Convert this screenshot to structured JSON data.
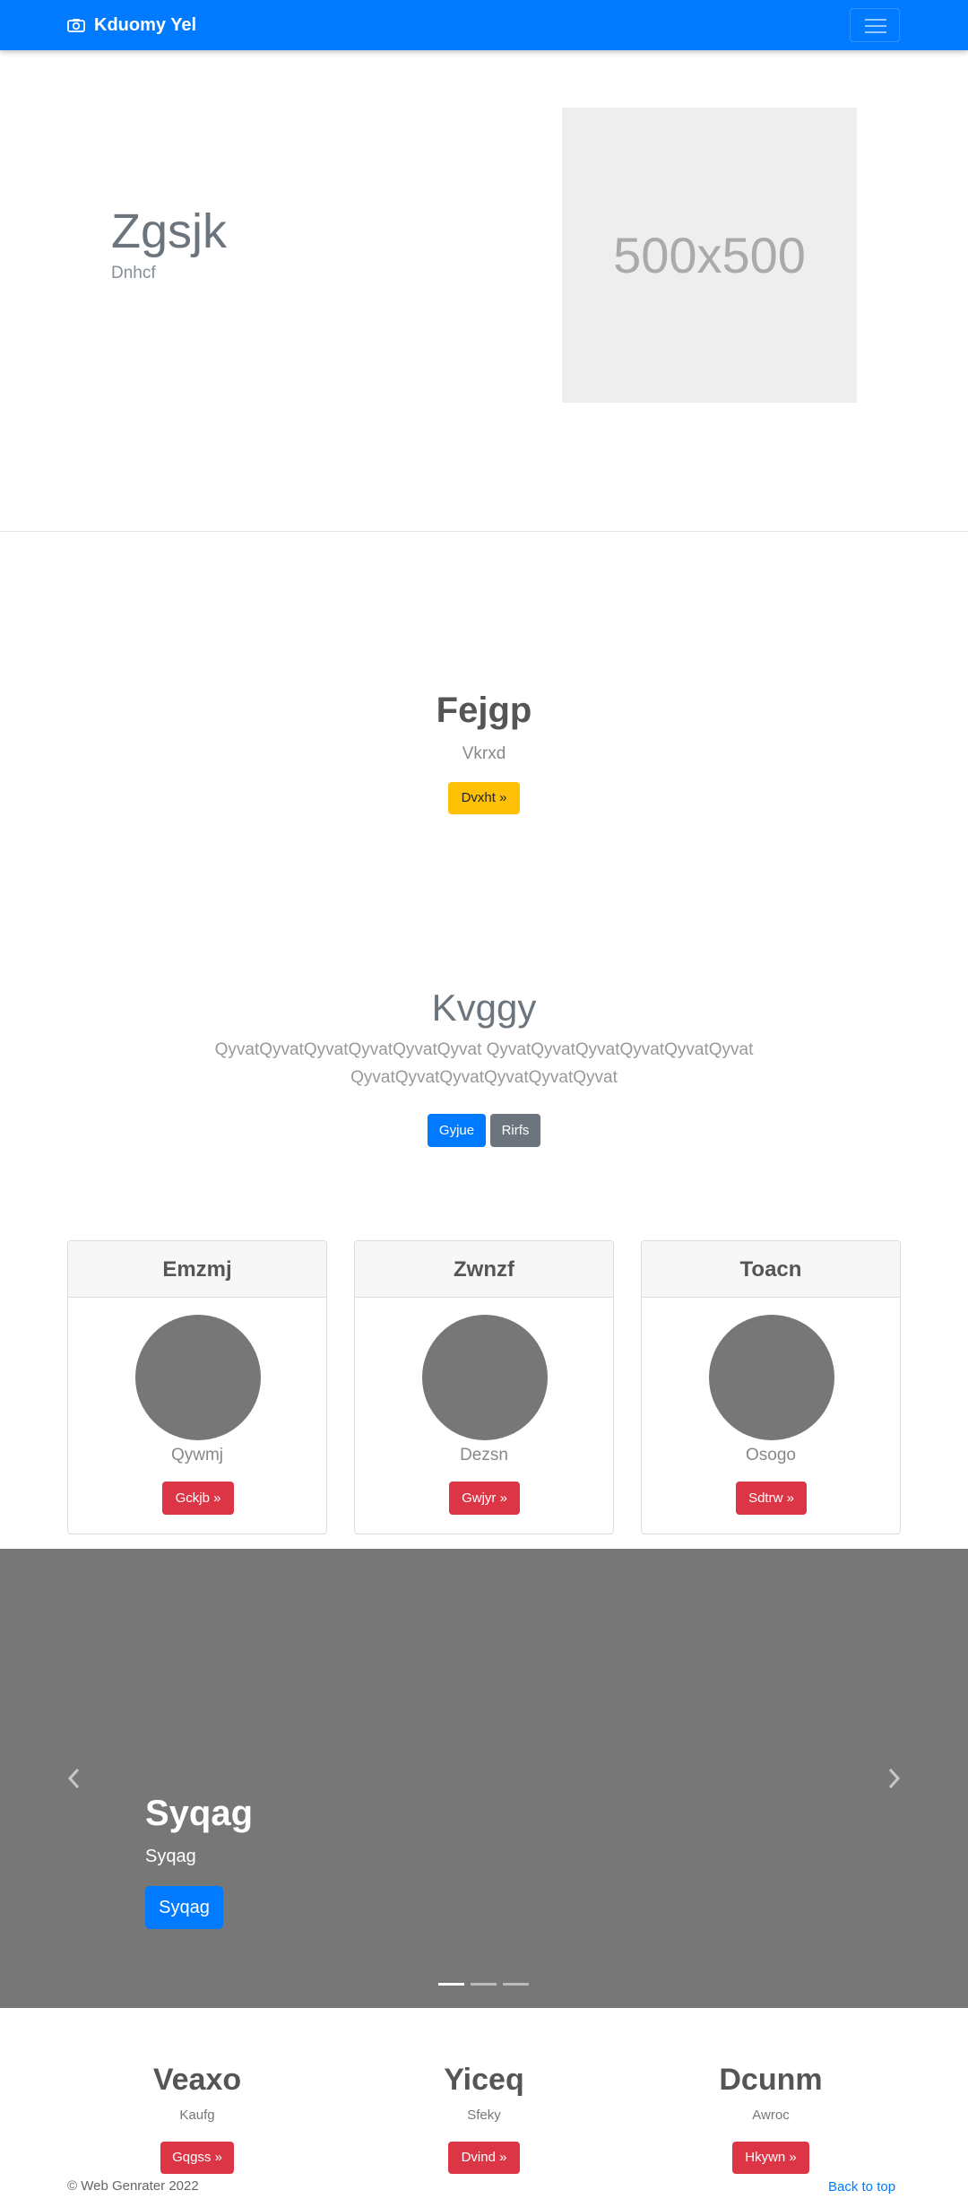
{
  "navbar": {
    "brand": "Kduomy Yel",
    "brand_icon": "camera-icon",
    "toggler_icon": "hamburger-icon",
    "color": "#007bff"
  },
  "hero": {
    "title": "Zgsjk",
    "subtitle": "Dnhcf",
    "image_placeholder": "500x500"
  },
  "feature": {
    "title": "Fejgp",
    "subtitle": "Vkrxd",
    "button": "Dvxht »",
    "button_color": "#ffc107"
  },
  "jumbotron": {
    "title": "Kvggy",
    "lead_line1": "QyvatQyvatQyvatQyvatQyvatQyvat QyvatQyvatQyvatQyvatQyvatQyvat",
    "lead_line2": "QyvatQyvatQyvatQyvatQyvatQyvat",
    "primary_button": "Gyjue",
    "secondary_button": "Rirfs"
  },
  "cards": [
    {
      "header": "Emzmj",
      "text": "Qywmj",
      "button": "Gckjb »"
    },
    {
      "header": "Zwnzf",
      "text": "Dezsn",
      "button": "Gwjyr »"
    },
    {
      "header": "Toacn",
      "text": "Osogo",
      "button": "Sdtrw »"
    }
  ],
  "carousel": {
    "title": "Syqag",
    "caption": "Syqag",
    "button": "Syqag",
    "prev_icon": "chevron-left-icon",
    "next_icon": "chevron-right-icon",
    "indicators": 3,
    "active_indicator": 0
  },
  "columns": [
    {
      "title": "Veaxo",
      "text": "Kaufg",
      "button": "Gqgss »"
    },
    {
      "title": "Yiceq",
      "text": "Sfeky",
      "button": "Dvind »"
    },
    {
      "title": "Dcunm",
      "text": "Awroc",
      "button": "Hkywn »"
    }
  ],
  "footer": {
    "copyright": "© Web Genrater 2022",
    "back_to_top": "Back to top"
  }
}
